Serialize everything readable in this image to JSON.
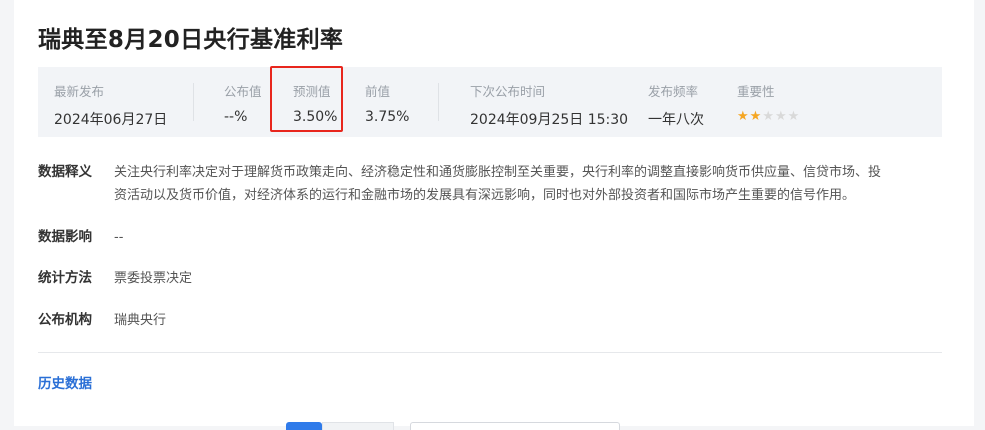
{
  "title": "瑞典至8月20日央行基准利率",
  "stats": {
    "latest_release": {
      "label": "最新发布",
      "value": "2024年06月27日"
    },
    "published": {
      "label": "公布值",
      "value": "--%"
    },
    "forecast": {
      "label": "预测值",
      "value": "3.50%"
    },
    "previous": {
      "label": "前值",
      "value": "3.75%"
    },
    "next_release": {
      "label": "下次公布时间",
      "value": "2024年09月25日 15:30"
    },
    "frequency": {
      "label": "发布频率",
      "value": "一年八次"
    },
    "importance": {
      "label": "重要性",
      "stars_filled": 2,
      "stars_total": 5,
      "star_color": "#f5a623"
    }
  },
  "highlight_color": "#e8261d",
  "details": {
    "interpretation": {
      "label": "数据释义",
      "line1": "关注央行利率决定对于理解货币政策走向、经济稳定性和通货膨胀控制至关重要，央行利率的调整直接影响货币供应量、信贷市场、投",
      "line2": "资活动以及货币价值，对经济体系的运行和金融市场的发展具有深远影响，同时也对外部投资者和国际市场产生重要的信号作用。"
    },
    "impact": {
      "label": "数据影响",
      "value": "--"
    },
    "method": {
      "label": "统计方法",
      "value": "票委投票决定"
    },
    "publisher": {
      "label": "公布机构",
      "value": "瑞典央行"
    }
  },
  "history_link": "历史数据",
  "accent_color": "#2a6fd6"
}
